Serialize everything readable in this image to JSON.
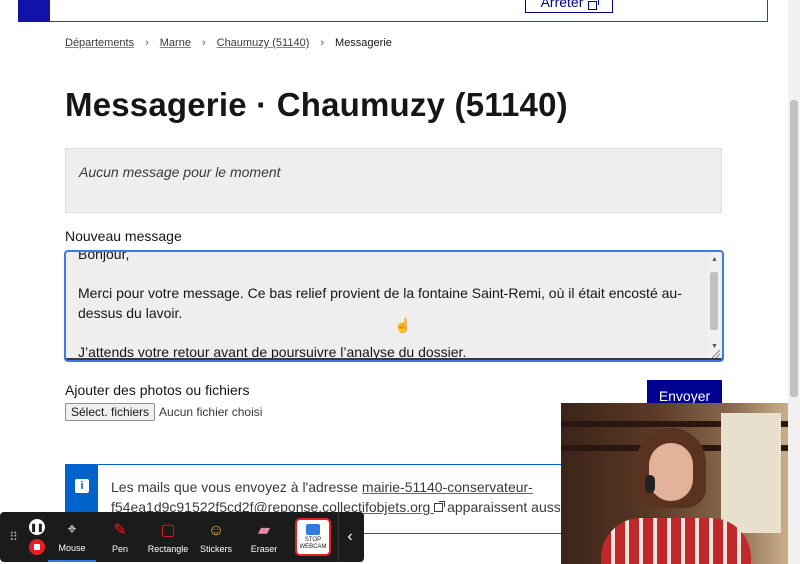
{
  "header": {
    "arreter_label": "Arrêter"
  },
  "breadcrumb": {
    "items": [
      "Départements",
      "Marne",
      "Chaumuzy (51140)"
    ],
    "current": "Messagerie",
    "separator": "›"
  },
  "page": {
    "title": "Messagerie · Chaumuzy (51140)"
  },
  "messages": {
    "empty_text": "Aucun message pour le moment"
  },
  "new_message": {
    "label": "Nouveau message",
    "value": "Bonjour,\n\nMerci pour votre message. Ce bas relief provient de la fontaine Saint-Remi, où il était encosté au-dessus du lavoir.\n\nJ’attends votre retour avant de poursuivre l’analyse du dossier."
  },
  "attachments": {
    "label": "Ajouter des photos ou fichiers",
    "button_label": "Sélect. fichiers",
    "no_file_text": "Aucun fichier choisi"
  },
  "send_button_label": "Envoyer",
  "info": {
    "text_before": "Les mails que vous envoyez à l'adresse ",
    "email": "mairie-51140-conservateur-f54ea1d9c91522f5cd2f@reponse.collectifobjets.org",
    "text_after": " apparaissent aussi"
  },
  "recorder_toolbar": {
    "tools": [
      {
        "label": "Mouse",
        "icon": "cursor-icon"
      },
      {
        "label": "Pen",
        "icon": "pen-icon"
      },
      {
        "label": "Rectangle",
        "icon": "rectangle-icon"
      },
      {
        "label": "Stickers",
        "icon": "sticker-icon"
      },
      {
        "label": "Eraser",
        "icon": "eraser-icon"
      }
    ],
    "webcam_line1": "STOP",
    "webcam_line2": "WEBCAM",
    "active_tool": "Mouse",
    "record_color": "#e52121",
    "active_color": "#2f7be0"
  },
  "colors": {
    "primary": "#000091",
    "info": "#0063cb"
  }
}
